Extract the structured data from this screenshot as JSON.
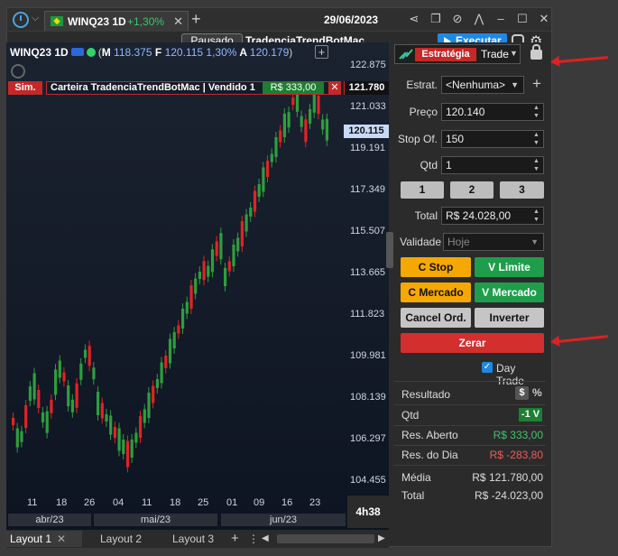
{
  "titlebar": {
    "tab_symbol": "WINQ23 1D",
    "tab_change": "+1,30%",
    "date": "29/06/2023"
  },
  "toolbar": {
    "status": "Pausado",
    "strategy_name": "TradenciaTrendBotMac",
    "execute_label": "Executar"
  },
  "chart": {
    "header_symbol": "WINQ23 1D",
    "m_label": "M",
    "m_value": "118.375",
    "f_label": "F",
    "f_value": "120.115",
    "pct": "1,30%",
    "a_label": "A",
    "a_value": "120.179",
    "sim_label": "Sim.",
    "portfolio_text": "Carteira TradenciaTrendBotMac | Vendido 1",
    "portfolio_pnl": "R$ 333,00",
    "tag_position": "121.780",
    "tag_last": "120.115",
    "timer": "4h38"
  },
  "chart_data": {
    "type": "candlestick",
    "yticks": [
      "122.875",
      "121.033",
      "119.191",
      "117.349",
      "115.507",
      "113.665",
      "111.823",
      "109.981",
      "108.139",
      "106.297",
      "104.455"
    ],
    "xticks": [
      "11",
      "18",
      "26",
      "04",
      "11",
      "18",
      "25",
      "01",
      "09",
      "16",
      "23"
    ],
    "months": [
      "abr/23",
      "mai/23",
      "jun/23"
    ],
    "colors": {
      "up": "#2e9e3e",
      "down": "#e02424"
    }
  },
  "bottom_tabs": [
    {
      "label": "Layout 1",
      "close": "✕"
    },
    {
      "label": "Layout 2"
    },
    {
      "label": "Layout 3"
    }
  ],
  "panel": {
    "strategy_badge": "Estratégia",
    "strategy_mode": "Trade",
    "estrat_label": "Estrat.",
    "estrat_value": "<Nenhuma>",
    "preco_label": "Preço",
    "preco_value": "120.140",
    "stop_label": "Stop Of.",
    "stop_value": "150",
    "qtd_label": "Qtd",
    "qtd_value": "1",
    "quick_qty": [
      "1",
      "2",
      "3"
    ],
    "total_label": "Total",
    "total_value": "R$ 24.028,00",
    "validade_label": "Validade",
    "validade_value": "Hoje",
    "btn_c_stop": "C Stop",
    "btn_v_limite": "V Limite",
    "btn_c_mercado": "C Mercado",
    "btn_v_mercado": "V Mercado",
    "btn_cancel": "Cancel Ord.",
    "btn_inverter": "Inverter",
    "btn_zerar": "Zerar",
    "daytrade_label": "Day Trade",
    "resultado_label": "Resultado",
    "dollar": "$",
    "percent": "%",
    "res_qtd_label": "Qtd",
    "res_qtd_value": "-1 V",
    "aberto_label": "Res. Aberto",
    "aberto_value": "R$ 333,00",
    "dia_label": "Res. do Dia",
    "dia_value": "R$ -283,80",
    "media_label": "Média",
    "media_value": "R$ 121.780,00",
    "total2_label": "Total",
    "total2_value": "R$ -24.023,00"
  }
}
